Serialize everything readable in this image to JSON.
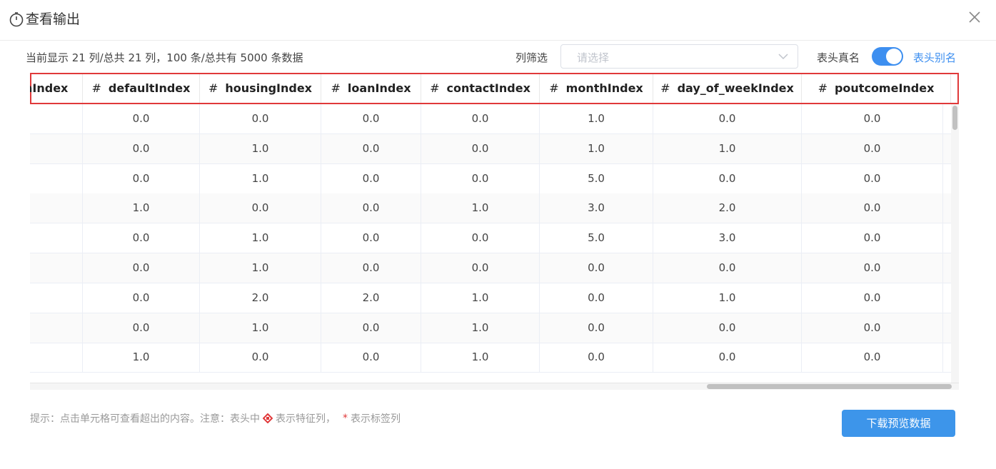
{
  "dialog": {
    "title": "查看输出"
  },
  "toolbar": {
    "info": "当前显示 21 列/总共 21 列，100 条/总共有 5000 条数据",
    "filter_label": "列筛选",
    "filter_placeholder": "请选择",
    "toggle_left_label": "表头真名",
    "toggle_right_label": "表头别名",
    "toggle_on": true
  },
  "table": {
    "columns": [
      {
        "hash": "",
        "name": "nIndex"
      },
      {
        "hash": "#",
        "name": "defaultIndex"
      },
      {
        "hash": "#",
        "name": "housingIndex"
      },
      {
        "hash": "#",
        "name": "loanIndex"
      },
      {
        "hash": "#",
        "name": "contactIndex"
      },
      {
        "hash": "#",
        "name": "monthIndex"
      },
      {
        "hash": "#",
        "name": "day_of_weekIndex"
      },
      {
        "hash": "#",
        "name": "poutcomeIndex"
      }
    ],
    "rows": [
      [
        "",
        "0.0",
        "0.0",
        "0.0",
        "0.0",
        "1.0",
        "0.0",
        "0.0"
      ],
      [
        "",
        "0.0",
        "1.0",
        "0.0",
        "0.0",
        "1.0",
        "1.0",
        "0.0"
      ],
      [
        "",
        "0.0",
        "1.0",
        "0.0",
        "0.0",
        "5.0",
        "0.0",
        "0.0"
      ],
      [
        "",
        "1.0",
        "0.0",
        "0.0",
        "1.0",
        "3.0",
        "2.0",
        "0.0"
      ],
      [
        "",
        "0.0",
        "1.0",
        "0.0",
        "0.0",
        "5.0",
        "3.0",
        "0.0"
      ],
      [
        "",
        "0.0",
        "1.0",
        "0.0",
        "0.0",
        "0.0",
        "0.0",
        "0.0"
      ],
      [
        "",
        "0.0",
        "2.0",
        "2.0",
        "1.0",
        "0.0",
        "1.0",
        "0.0"
      ],
      [
        "",
        "0.0",
        "1.0",
        "0.0",
        "1.0",
        "0.0",
        "0.0",
        "0.0"
      ],
      [
        "",
        "1.0",
        "0.0",
        "0.0",
        "1.0",
        "0.0",
        "0.0",
        "0.0"
      ]
    ]
  },
  "footer": {
    "hint_prefix": "提示：点击单元格可查看超出的内容。注意：表头中",
    "hint_feature": "表示特征列，",
    "hint_star": "*",
    "hint_label": "表示标签列",
    "download_label": "下载预览数据"
  },
  "colors": {
    "accent": "#3d8ff0",
    "highlight_border": "#e0393a"
  }
}
